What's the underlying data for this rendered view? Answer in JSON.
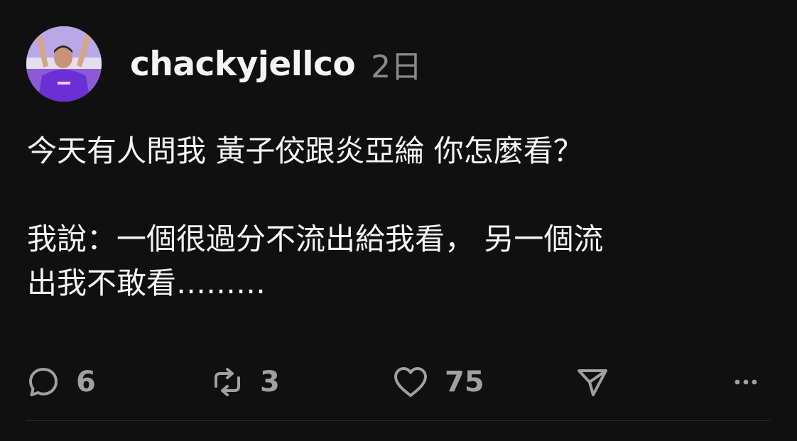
{
  "post": {
    "username": "chackyjellco",
    "timestamp": "2日",
    "text": "今天有人問我 黃子佼跟炎亞綸 你怎麼看？\n\n我說：一個很過分不流出給我看， 另一個流\n出我不敢看………",
    "avatar_icon": "profile-photo-person-arms-raised"
  },
  "actions": {
    "reply": {
      "icon": "comment-bubble-icon",
      "count": "6"
    },
    "repost": {
      "icon": "repost-arrows-icon",
      "count": "3"
    },
    "like": {
      "icon": "heart-icon",
      "count": "75"
    },
    "share": {
      "icon": "send-icon"
    },
    "more": {
      "icon": "more-dots-icon"
    }
  },
  "colors": {
    "background": "#101010",
    "text": "#f3f5f7",
    "muted": "#8a8a8a",
    "icon": "#a0a0a0",
    "avatar_accent": "#6b2fd6"
  }
}
